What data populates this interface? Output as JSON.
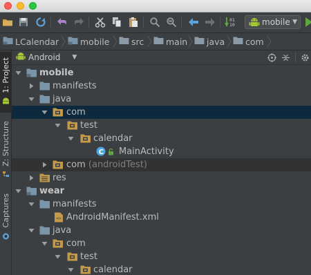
{
  "window": {
    "controls": [
      "close",
      "minimize",
      "zoom"
    ]
  },
  "toolbar": {
    "buttons": [
      "open-folder-icon",
      "save-icon",
      "sync-icon",
      "undo-icon",
      "redo-icon",
      "cut-icon",
      "copy-icon",
      "paste-icon",
      "find-icon",
      "replace-icon",
      "back-icon",
      "forward-icon",
      "make-project-icon"
    ],
    "run_config": "mobile"
  },
  "breadcrumb": [
    {
      "label": "LCalendar",
      "icon": "module-folder-icon"
    },
    {
      "label": "mobile",
      "icon": "module-folder-icon"
    },
    {
      "label": "src",
      "icon": "folder-icon"
    },
    {
      "label": "main",
      "icon": "folder-icon"
    },
    {
      "label": "java",
      "icon": "folder-icon"
    },
    {
      "label": "com",
      "icon": "folder-icon"
    }
  ],
  "side_strip": [
    {
      "label": "1: Project",
      "active": true
    },
    {
      "label": "Z: Structure",
      "active": false
    },
    {
      "label": "Captures",
      "active": false
    }
  ],
  "panel": {
    "view": "Android"
  },
  "tree": [
    {
      "label": "mobile",
      "bold": true
    },
    {
      "label": "manifests"
    },
    {
      "label": "java"
    },
    {
      "label": "com"
    },
    {
      "label": "test"
    },
    {
      "label": "calendar"
    },
    {
      "label": "MainActivity"
    },
    {
      "label": "com",
      "suffix": "(androidTest)"
    },
    {
      "label": "res"
    },
    {
      "label": "wear",
      "bold": true
    },
    {
      "label": "manifests"
    },
    {
      "label": "AndroidManifest.xml"
    },
    {
      "label": "java"
    },
    {
      "label": "com"
    },
    {
      "label": "test"
    },
    {
      "label": "calendar"
    }
  ],
  "colors": {
    "background": "#3c3f41",
    "selection": "#0d293e",
    "text": "#bbbbbb",
    "folder_module": "#7a94a8",
    "folder_package": "#c29a4a",
    "android_green": "#a4c639"
  }
}
